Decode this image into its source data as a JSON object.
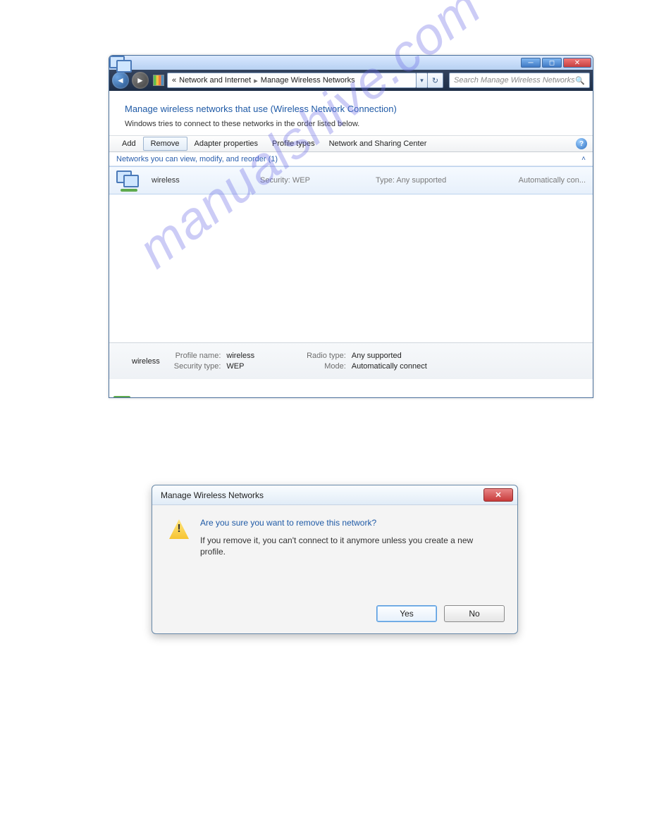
{
  "window": {
    "breadcrumb_prefix": "«",
    "breadcrumb1": "Network and Internet",
    "breadcrumb2": "Manage Wireless Networks",
    "search_placeholder": "Search Manage Wireless Networks",
    "heading": "Manage wireless networks that use (Wireless Network Connection)",
    "subheading": "Windows tries to connect to these networks in the order listed below.",
    "toolbar": {
      "add": "Add",
      "remove": "Remove",
      "props": "Adapter properties",
      "types": "Profile types",
      "center": "Network and Sharing Center"
    },
    "group_header": "Networks you can view, modify, and reorder (1)",
    "row": {
      "name": "wireless",
      "security": "Security: WEP",
      "type": "Type: Any supported",
      "auto": "Automatically con..."
    },
    "details": {
      "name": "wireless",
      "profile_lbl": "Profile name:",
      "profile_val": "wireless",
      "sectype_lbl": "Security type:",
      "sectype_val": "WEP",
      "radio_lbl": "Radio type:",
      "radio_val": "Any supported",
      "mode_lbl": "Mode:",
      "mode_val": "Automatically connect"
    }
  },
  "dialog": {
    "title": "Manage Wireless Networks",
    "question": "Are you sure you want to remove this network?",
    "detail": "If you remove it, you can't connect to it anymore unless you create a new profile.",
    "yes": "Yes",
    "no": "No"
  },
  "watermark": "manualshive.com"
}
